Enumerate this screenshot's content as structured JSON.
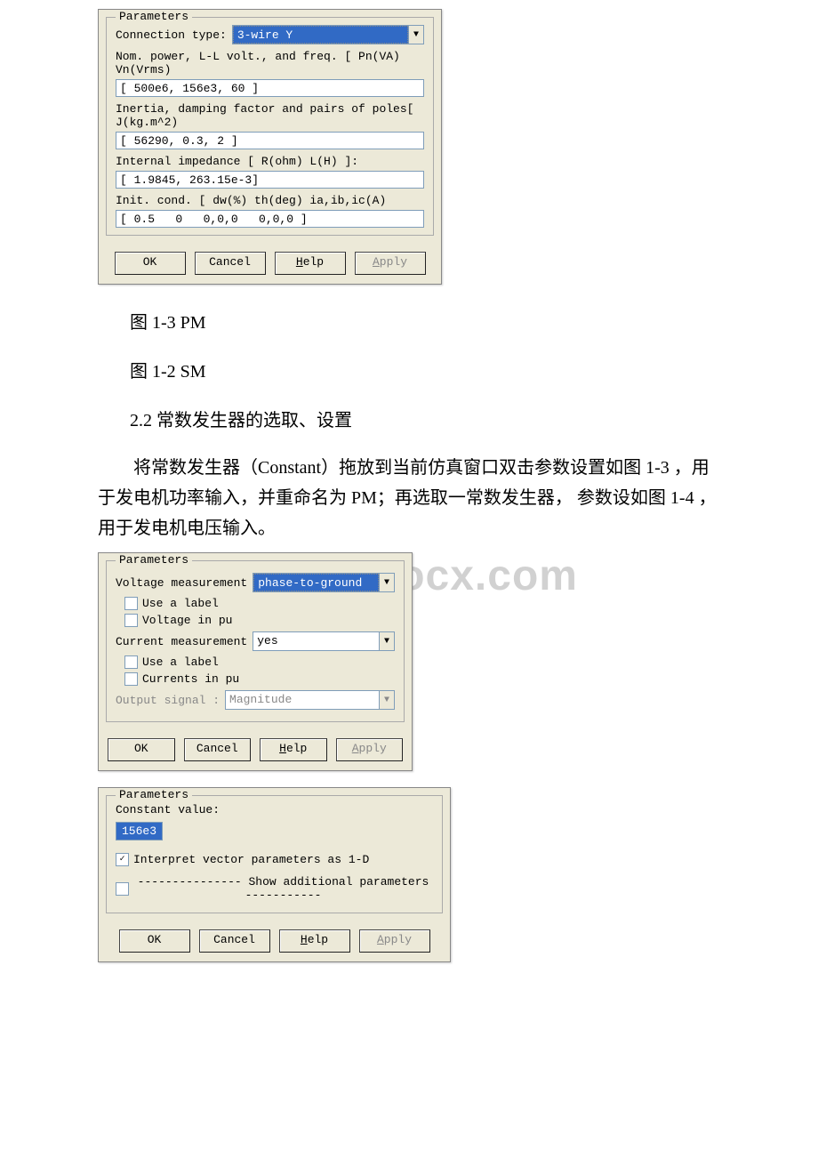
{
  "dialog1": {
    "legend": "Parameters",
    "connection_label": "Connection type:",
    "connection_value": "3-wire Y",
    "nom_label": "Nom. power, L-L volt., and freq. [ Pn(VA) Vn(Vrms)",
    "nom_value": "[ 500e6, 156e3, 60 ]",
    "inertia_label": "Inertia, damping factor and pairs of poles[ J(kg.m^2)",
    "inertia_value": "[ 56290, 0.3, 2 ]",
    "impedance_label": "Internal impedance [ R(ohm)  L(H) ]:",
    "impedance_value": "[ 1.9845, 263.15e-3]",
    "init_label": "Init. cond. [ dw(%)  th(deg)  ia,ib,ic(A)",
    "init_value": "[ 0.5   0   0,0,0   0,0,0 ]",
    "buttons": {
      "ok": "OK",
      "cancel": "Cancel",
      "help": "Help",
      "apply": "Apply"
    }
  },
  "captions": {
    "c1": "图 1-3 PM",
    "c2": "图 1-2 SM"
  },
  "section": {
    "heading": "2.2 常数发生器的选取、设置",
    "para": "将常数发生器（Constant）拖放到当前仿真窗口双击参数设置如图 1-3 ，用于发电机功率输入，并重命名为 PM；再选取一常数发生器， 参数设如图 1-4 ，用于发电机电压输入。"
  },
  "watermark": "www.bdocx.com",
  "dialog2": {
    "legend": "Parameters",
    "vm_label": "Voltage measurement",
    "vm_value": "phase-to-ground",
    "use_label_v": "Use a label",
    "voltage_pu": "Voltage  in pu",
    "cm_label": "Current measurement",
    "cm_value": "yes",
    "use_label_c": "Use a label",
    "currents_pu": "Currents in pu",
    "out_label": "Output signal :",
    "out_value": "Magnitude",
    "buttons": {
      "ok": "OK",
      "cancel": "Cancel",
      "help": "Help",
      "apply": "Apply"
    }
  },
  "dialog3": {
    "legend": "Parameters",
    "const_label": "Constant value:",
    "const_value": "156e3",
    "interpret": "Interpret vector parameters as 1-D",
    "show_additional": "--------------- Show additional parameters -----------",
    "buttons": {
      "ok": "OK",
      "cancel": "Cancel",
      "help": "Help",
      "apply": "Apply"
    }
  }
}
